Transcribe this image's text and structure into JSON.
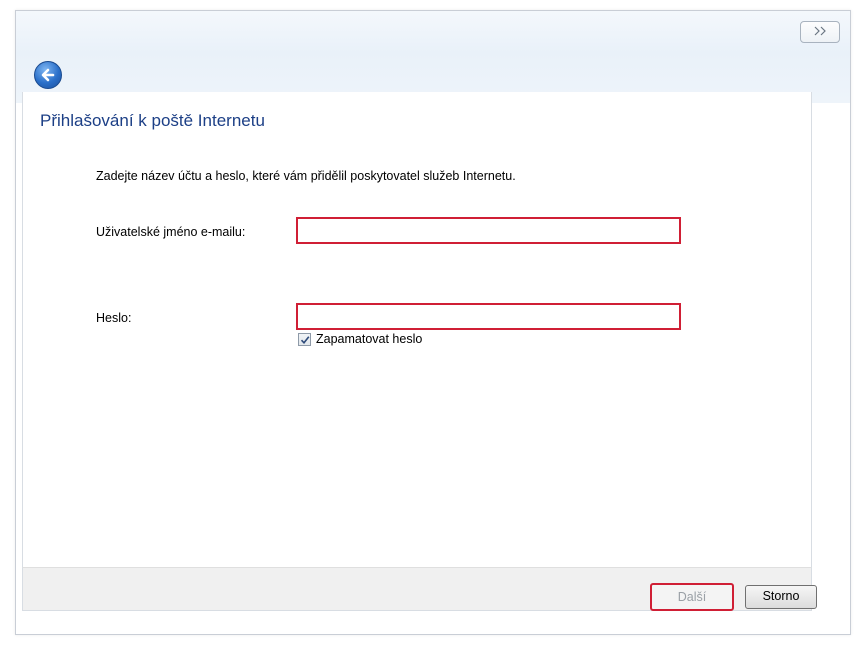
{
  "window": {
    "close_label": "☒"
  },
  "page": {
    "title": "Přihlašování k poště Internetu",
    "instruction": "Zadejte název účtu a heslo, které vám přidělil poskytovatel služeb Internetu."
  },
  "form": {
    "username_label": "Uživatelské jméno e-mailu:",
    "username_value": "",
    "password_label": "Heslo:",
    "password_value": "",
    "remember_label": "Zapamatovat heslo",
    "remember_checked": true
  },
  "footer": {
    "next_label": "Další",
    "cancel_label": "Storno"
  },
  "colors": {
    "highlight": "#d01f35",
    "title": "#1c3f86"
  }
}
